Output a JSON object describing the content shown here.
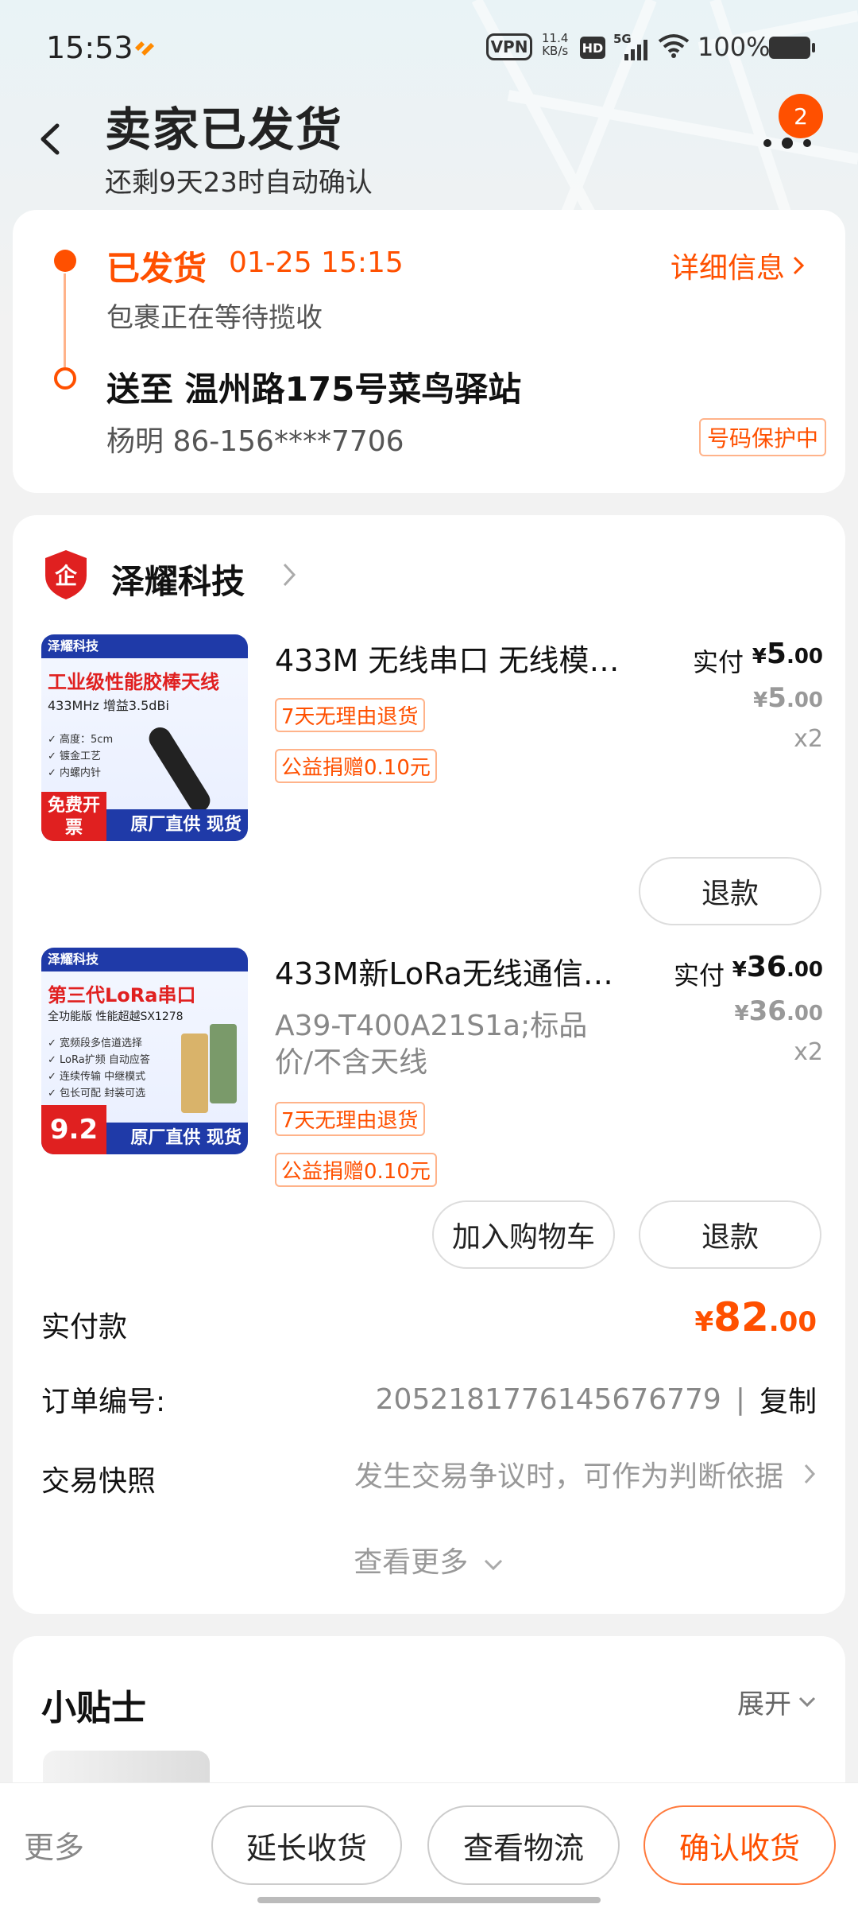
{
  "status_bar": {
    "time": "15:53",
    "vpn": "VPN",
    "speed_value": "11.4",
    "speed_unit": "KB/s",
    "hd": "HD",
    "network": "5G",
    "battery": "100%"
  },
  "header": {
    "title": "卖家已发货",
    "subtitle": "还剩9天23时自动确认",
    "badge_count": "2"
  },
  "logistics": {
    "status": "已发货",
    "time": "01-25 15:15",
    "detail_link": "详细信息",
    "description": "包裹正在等待揽收",
    "address": "送至 温州路175号菜鸟驿站",
    "contact": "杨明 86-156****7706",
    "privacy_tag": "号码保护中"
  },
  "shop": {
    "name": "泽耀科技"
  },
  "items": [
    {
      "title": "433M 无线串口 无线模…",
      "spec": "",
      "tags": [
        "7天无理由退货",
        "公益捐赠0.10元"
      ],
      "paid_label": "实付",
      "currency": "¥",
      "paid_int": "5",
      "paid_dec": ".00",
      "orig_int": "5",
      "orig_dec": ".00",
      "qty": "x2",
      "buttons": [
        "退款"
      ],
      "thumb": {
        "head": "泽耀科技",
        "title": "工业级性能胶棒天线",
        "sub": "433MHz 增益3.5dBi",
        "list": [
          "✓ 高度：5cm",
          "✓ 镀金工艺",
          "✓ 内螺内针"
        ],
        "tag": "免费开票",
        "foot": "原厂直供 现货"
      }
    },
    {
      "title": "433M新LoRa无线通信…",
      "spec": "A39-T400A21S1a;标品价/不含天线",
      "tags": [
        "7天无理由退货",
        "公益捐赠0.10元"
      ],
      "paid_label": "实付",
      "currency": "¥",
      "paid_int": "36",
      "paid_dec": ".00",
      "orig_int": "36",
      "orig_dec": ".00",
      "qty": "x2",
      "buttons": [
        "加入购物车",
        "退款"
      ],
      "thumb": {
        "head": "泽耀科技",
        "title": "第三代LoRa串口",
        "sub": "全功能版 性能超越SX1278",
        "list": [
          "✓ 宽频段多信道选择",
          "✓ LoRa扩频 自动应答",
          "✓ 连续传输 中继模式",
          "✓ 包长可配 封装可选"
        ],
        "tag": "9.2",
        "foot": "原厂直供 现货"
      }
    }
  ],
  "summary": {
    "total_label": "实付款",
    "total_currency": "¥",
    "total_int": "82",
    "total_dec": ".00",
    "order_label": "订单编号:",
    "order_no": "2052181776145676779",
    "copy": "复制",
    "snapshot_label": "交易快照",
    "snapshot_hint": "发生交易争议时，可作为判断依据",
    "see_more": "查看更多"
  },
  "tips": {
    "title": "小贴士",
    "expand": "展开"
  },
  "bottom_bar": {
    "more": "更多",
    "extend": "延长收货",
    "track": "查看物流",
    "confirm": "确认收货"
  },
  "colors": {
    "accent": "#ff5000",
    "accent_light": "#ffb38a",
    "brand_blue": "#1f3aa8"
  }
}
